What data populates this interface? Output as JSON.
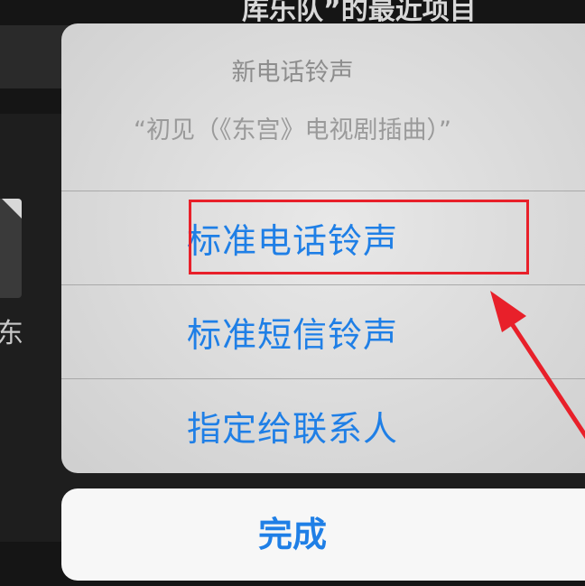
{
  "background": {
    "header_text": "库乐队”的最近项目",
    "list_item_text": "东"
  },
  "action_sheet": {
    "title": "新电话铃声",
    "subtitle": "“初见（《东宫》电视剧插曲）”",
    "options": [
      {
        "label": "标准电话铃声"
      },
      {
        "label": "标准短信铃声"
      },
      {
        "label": "指定给联系人"
      }
    ],
    "done_label": "完成"
  },
  "annotation": {
    "highlight_color": "#e8202a",
    "highlighted_option": "标准电话铃声"
  },
  "colors": {
    "accent": "#1f7fe6",
    "title_gray": "#8d8d8d"
  }
}
